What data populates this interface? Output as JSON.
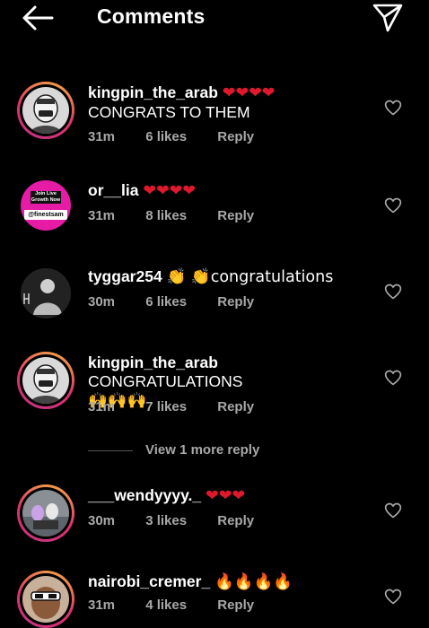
{
  "header": {
    "title": "Comments"
  },
  "comments": [
    {
      "username": "kingpin_the_arab",
      "text_inline": "❤❤❤❤",
      "text_line2": "CONGRATS TO THEM",
      "time": "31m",
      "likes": "6 likes",
      "reply": "Reply"
    },
    {
      "username": "or__lia",
      "text_inline": "❤❤❤❤",
      "time": "31m",
      "likes": "8 likes",
      "reply": "Reply",
      "avatar_text_top": "Join Live Growth Now",
      "avatar_text_bottom": "@finestsam"
    },
    {
      "username": "tyggar254",
      "text_inline": "👏 👏congratulations",
      "time": "30m",
      "likes": "6 likes",
      "reply": "Reply"
    },
    {
      "username": "kingpin_the_arab",
      "text_inline": "CONGRATULATIONS",
      "text_line2": "🙌🙌🙌",
      "time": "31m",
      "likes": "7 likes",
      "reply": "Reply"
    },
    {
      "username": "___wendyyyy._",
      "text_inline": "❤❤❤",
      "time": "30m",
      "likes": "3 likes",
      "reply": "Reply"
    },
    {
      "username": "nairobi_cremer_",
      "text_inline": "🔥🔥🔥🔥",
      "time": "31m",
      "likes": "4 likes",
      "reply": "Reply"
    }
  ],
  "view_more": "View 1 more reply",
  "colors": {
    "background": "#000000",
    "meta": "#a8a8a8",
    "heart": "#e0182d",
    "ring": "#e1306c"
  },
  "icons": [
    "back-arrow-icon",
    "send-icon",
    "heart-outline-icon"
  ]
}
